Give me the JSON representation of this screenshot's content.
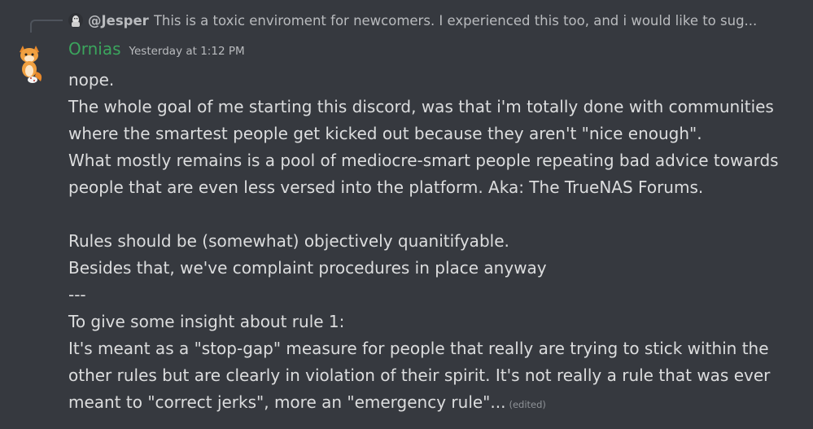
{
  "reply": {
    "username": "@Jesper",
    "text": "This is a toxic enviroment for newcomers. I experienced this too, and i would like to sug..."
  },
  "message": {
    "author": "Ornias",
    "timestamp": "Yesterday at 1:12 PM",
    "lines": [
      "nope.",
      "The whole goal of me starting this discord, was that i'm totally done with communities",
      "where the smartest people get kicked out because they aren't \"nice enough\".",
      "What mostly remains is a pool of mediocre-smart people repeating bad advice towards",
      "people that are even less versed into the platform. Aka: The TrueNAS Forums.",
      "",
      "Rules should be (somewhat) objectively quanitifyable.",
      "Besides that, we've complaint procedures in place anyway",
      "---",
      "To give some insight about rule 1:",
      "It's meant as a \"stop-gap\" measure for people that really are trying to stick within the",
      "other rules but are clearly in violation of their spirit. It's not really a rule that was ever",
      "meant to \"correct jerks\", more an \"emergency rule\"..."
    ],
    "edited_label": "(edited)"
  },
  "colors": {
    "background": "#36393f",
    "author": "#3ba55d",
    "text": "#dcddde",
    "muted": "#b9bbbe"
  },
  "icons": {
    "reply_avatar": "reply-avatar-icon",
    "author_avatar": "fox-avatar-icon"
  }
}
